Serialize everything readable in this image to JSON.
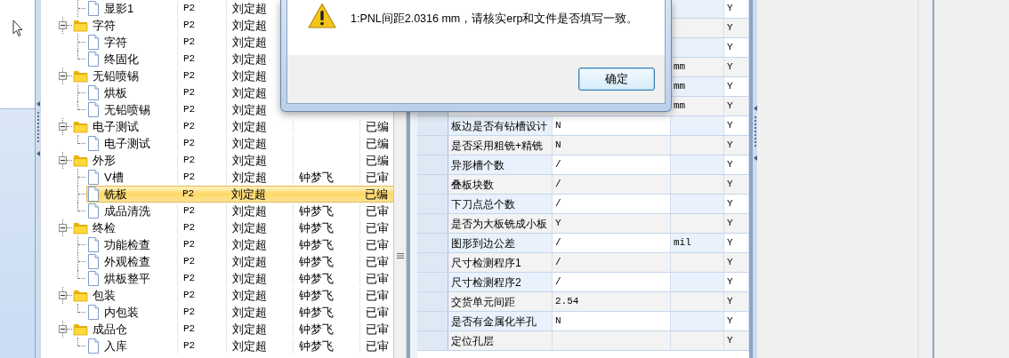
{
  "tree": {
    "rows": [
      {
        "kind": "file",
        "name": "显影1",
        "selected": false,
        "cells": [
          "P2",
          "刘定超"
        ]
      },
      {
        "kind": "folder",
        "name": "字符",
        "expanded": true,
        "selected": false,
        "cells": [
          "P2",
          "刘定超"
        ],
        "children": [
          {
            "kind": "file",
            "name": "字符",
            "selected": false,
            "cells": [
              "P2",
              "刘定超"
            ]
          },
          {
            "kind": "file",
            "name": "终固化",
            "selected": false,
            "cells": [
              "P2",
              "刘定超"
            ]
          }
        ]
      },
      {
        "kind": "folder",
        "name": "无铅喷锡",
        "expanded": true,
        "selected": false,
        "cells": [
          "P2",
          "刘定超"
        ],
        "children": [
          {
            "kind": "file",
            "name": "烘板",
            "selected": false,
            "cells": [
              "P2",
              "刘定超"
            ]
          },
          {
            "kind": "file",
            "name": "无铅喷锡",
            "selected": false,
            "cells": [
              "P2",
              "刘定超"
            ]
          }
        ]
      },
      {
        "kind": "folder",
        "name": "电子测试",
        "expanded": true,
        "selected": false,
        "cells": [
          "P2",
          "刘定超",
          "",
          "已编"
        ],
        "children": [
          {
            "kind": "file",
            "name": "电子测试",
            "selected": false,
            "cells": [
              "P2",
              "刘定超",
              "",
              "已编"
            ]
          }
        ]
      },
      {
        "kind": "folder",
        "name": "外形",
        "expanded": true,
        "selected": false,
        "cells": [
          "P2",
          "刘定超",
          "",
          "已编"
        ],
        "children": [
          {
            "kind": "file",
            "name": "V槽",
            "selected": false,
            "cells": [
              "P2",
              "刘定超",
              "钟梦飞",
              "已审"
            ]
          },
          {
            "kind": "file",
            "name": "铣板",
            "selected": true,
            "cells": [
              "P2",
              "刘定超",
              "",
              "已编"
            ]
          },
          {
            "kind": "file",
            "name": "成品清洗",
            "selected": false,
            "cells": [
              "P2",
              "刘定超",
              "钟梦飞",
              "已审"
            ]
          }
        ]
      },
      {
        "kind": "folder",
        "name": "终检",
        "expanded": true,
        "selected": false,
        "cells": [
          "P2",
          "刘定超",
          "钟梦飞",
          "已审"
        ],
        "children": [
          {
            "kind": "file",
            "name": "功能检查",
            "selected": false,
            "cells": [
              "P2",
              "刘定超",
              "钟梦飞",
              "已审"
            ]
          },
          {
            "kind": "file",
            "name": "外观检查",
            "selected": false,
            "cells": [
              "P2",
              "刘定超",
              "钟梦飞",
              "已审"
            ]
          },
          {
            "kind": "file",
            "name": "烘板整平",
            "selected": false,
            "cells": [
              "P2",
              "刘定超",
              "钟梦飞",
              "已审"
            ]
          }
        ]
      },
      {
        "kind": "folder",
        "name": "包装",
        "expanded": true,
        "selected": false,
        "cells": [
          "P2",
          "刘定超",
          "钟梦飞",
          "已审"
        ],
        "children": [
          {
            "kind": "file",
            "name": "内包装",
            "selected": false,
            "cells": [
              "P2",
              "刘定超",
              "钟梦飞",
              "已审"
            ]
          }
        ]
      },
      {
        "kind": "folder",
        "name": "成品仓",
        "expanded": true,
        "selected": false,
        "cells": [
          "P2",
          "刘定超",
          "钟梦飞",
          "已审"
        ],
        "children": [
          {
            "kind": "file",
            "name": "入库",
            "selected": false,
            "cells": [
              "P2",
              "刘定超",
              "钟梦飞",
              "已审"
            ]
          }
        ]
      }
    ]
  },
  "grid": {
    "rows": [
      {
        "flag": "Y"
      },
      {
        "flag": "Y"
      },
      {
        "flag": "Y"
      },
      {
        "unit": "mm",
        "flag": "Y"
      },
      {
        "unit": "mm",
        "flag": "Y"
      },
      {
        "unit": "mm",
        "flag": "Y"
      },
      {
        "name": "板边是否有钻槽设计",
        "value": "N",
        "flag": "Y"
      },
      {
        "name": "是否采用粗铣+精铣",
        "value": "N",
        "flag": "Y"
      },
      {
        "name": "异形槽个数",
        "value": "/",
        "flag": "Y"
      },
      {
        "name": "叠板块数",
        "value": "/",
        "flag": "Y"
      },
      {
        "name": "下刀点总个数",
        "value": "/",
        "flag": "Y"
      },
      {
        "name": "是否为大板铣成小板",
        "value": "Y",
        "flag": "Y"
      },
      {
        "name": "图形到边公差",
        "value": "/",
        "unit": "mil",
        "flag": "Y"
      },
      {
        "name": "尺寸检测程序1",
        "value": "/",
        "flag": "Y"
      },
      {
        "name": "尺寸检测程序2",
        "value": "/",
        "flag": "Y"
      },
      {
        "name": "交货单元间距",
        "value": "2.54",
        "flag": "Y"
      },
      {
        "name": "是否有金属化半孔",
        "value": "N",
        "flag": "Y"
      },
      {
        "name": "定位孔层",
        "flag": "Y"
      }
    ]
  },
  "dialog": {
    "kind": "warning",
    "message": "1:PNL间距2.0316 mm，请核实erp和文件是否填写一致。",
    "buttons": [
      "确定"
    ]
  }
}
